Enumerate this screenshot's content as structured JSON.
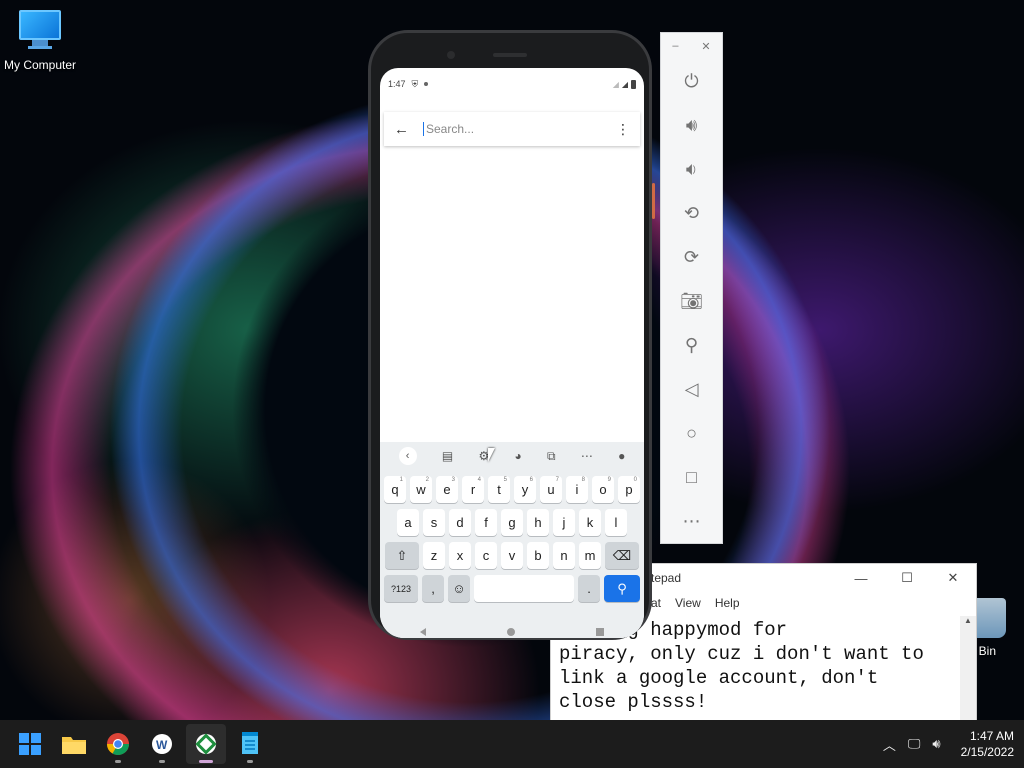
{
  "desktop": {
    "icons": [
      {
        "label": "My Computer",
        "icon": "monitor-icon"
      },
      {
        "label": "le Bin",
        "icon": "recycle-bin-icon"
      }
    ]
  },
  "phone": {
    "status": {
      "time": "1:47"
    },
    "search": {
      "placeholder": "Search..."
    },
    "keyboard": {
      "toolbar": [
        "chevron-left-icon",
        "clipboard-icon",
        "gear-icon",
        "palette-icon",
        "resize-icon",
        "more-horiz-icon",
        "mic-icon"
      ],
      "row1": [
        {
          "k": "q",
          "sup": "1"
        },
        {
          "k": "w",
          "sup": "2"
        },
        {
          "k": "e",
          "sup": "3"
        },
        {
          "k": "r",
          "sup": "4"
        },
        {
          "k": "t",
          "sup": "5"
        },
        {
          "k": "y",
          "sup": "6"
        },
        {
          "k": "u",
          "sup": "7"
        },
        {
          "k": "i",
          "sup": "8"
        },
        {
          "k": "o",
          "sup": "9"
        },
        {
          "k": "p",
          "sup": "0"
        }
      ],
      "row2": [
        "a",
        "s",
        "d",
        "f",
        "g",
        "h",
        "j",
        "k",
        "l"
      ],
      "row3": [
        "z",
        "x",
        "c",
        "v",
        "b",
        "n",
        "m"
      ],
      "numbers_key": "?123",
      "comma_key": ",",
      "period_key": "."
    }
  },
  "emulator_toolbar": {
    "window_controls": {
      "minimize": "–",
      "close": "✕"
    },
    "buttons": [
      "power-icon",
      "volume-up-icon",
      "volume-down-icon",
      "rotate-left-icon",
      "rotate-right-icon",
      "camera-icon",
      "zoom-icon",
      "back-icon",
      "home-icon",
      "overview-icon",
      "more-icon"
    ]
  },
  "notepad": {
    "title": "tepad",
    "menu": [
      "at",
      "View",
      "Help"
    ],
    "text": "t using happymod for\npiracy, only cuz i don't want to\nlink a google account, don't\nclose plssss!",
    "controls": {
      "minimize": "—",
      "maximize": "☐",
      "close": "✕"
    }
  },
  "taskbar": {
    "apps": [
      "windows-start-icon",
      "file-explorer-icon",
      "chrome-icon",
      "wordpad-icon",
      "android-emulator-icon",
      "notepad-icon"
    ],
    "clock": {
      "time": "1:47 AM",
      "date": "2/15/2022"
    }
  }
}
